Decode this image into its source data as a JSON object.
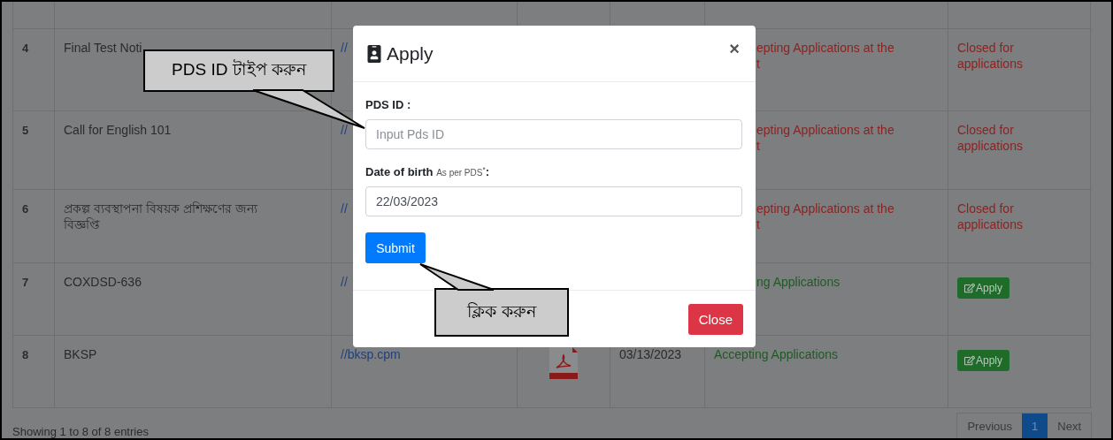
{
  "table": {
    "rows": [
      {
        "number": "4",
        "title": "Final Test Noti",
        "link": "//",
        "covered": true,
        "status_lines": [
          "epting Applications at the",
          "t"
        ],
        "color": "#8d2222",
        "action": {
          "kind": "text",
          "label": "Closed for applications"
        }
      },
      {
        "number": "5",
        "title": "Call for English 101",
        "link": "//",
        "covered": true,
        "status_lines": [
          "epting Applications at the",
          "t"
        ],
        "color": "#8d2222",
        "action": {
          "kind": "text",
          "label": "Closed for applications"
        }
      },
      {
        "number": "6",
        "title": "প্রকল্প ব্যবস্থাপনা বিষয়ক প্রশিক্ষণের জন্য বিজ্ঞপ্তি",
        "link": "//",
        "covered": true,
        "status_lines": [
          "epting Applications at the",
          "t"
        ],
        "color": "#8d2222",
        "action": {
          "kind": "text",
          "label": "Closed for applications"
        }
      },
      {
        "number": "7",
        "title": "COXDSD-636",
        "link": "//",
        "covered": true,
        "status_lines": [
          "ng Applications"
        ],
        "color": "#1f5a24",
        "action": {
          "kind": "button",
          "label": "Apply"
        }
      },
      {
        "number": "8",
        "title": "BKSP",
        "link": "//bksp.cpm",
        "covered": false,
        "pdf": true,
        "date": "03/13/2023",
        "status_lines": [
          "Accepting Applications"
        ],
        "color": "#1f5a24",
        "action": {
          "kind": "button",
          "label": "Apply"
        }
      }
    ]
  },
  "footer": {
    "info": "Showing 1 to 8 of 8 entries",
    "pagination": [
      {
        "label": "Previous",
        "selected": false
      },
      {
        "label": "1",
        "selected": true
      },
      {
        "label": "Next",
        "selected": false
      }
    ]
  },
  "modal": {
    "title": "Apply",
    "close_symbol": "×",
    "pds_label": "PDS ID :",
    "pds_placeholder": "Input Pds ID",
    "dob_label": "Date of birth",
    "dob_hint": "As per PDS",
    "dob_mark": "*",
    "dob_colon": ":",
    "dob_value": "22/03/2023",
    "submit": "Submit",
    "close": "Close"
  },
  "callouts": [
    {
      "text": "PDS ID টাইপ করুন"
    },
    {
      "text": "ক্লিক করুন"
    }
  ]
}
